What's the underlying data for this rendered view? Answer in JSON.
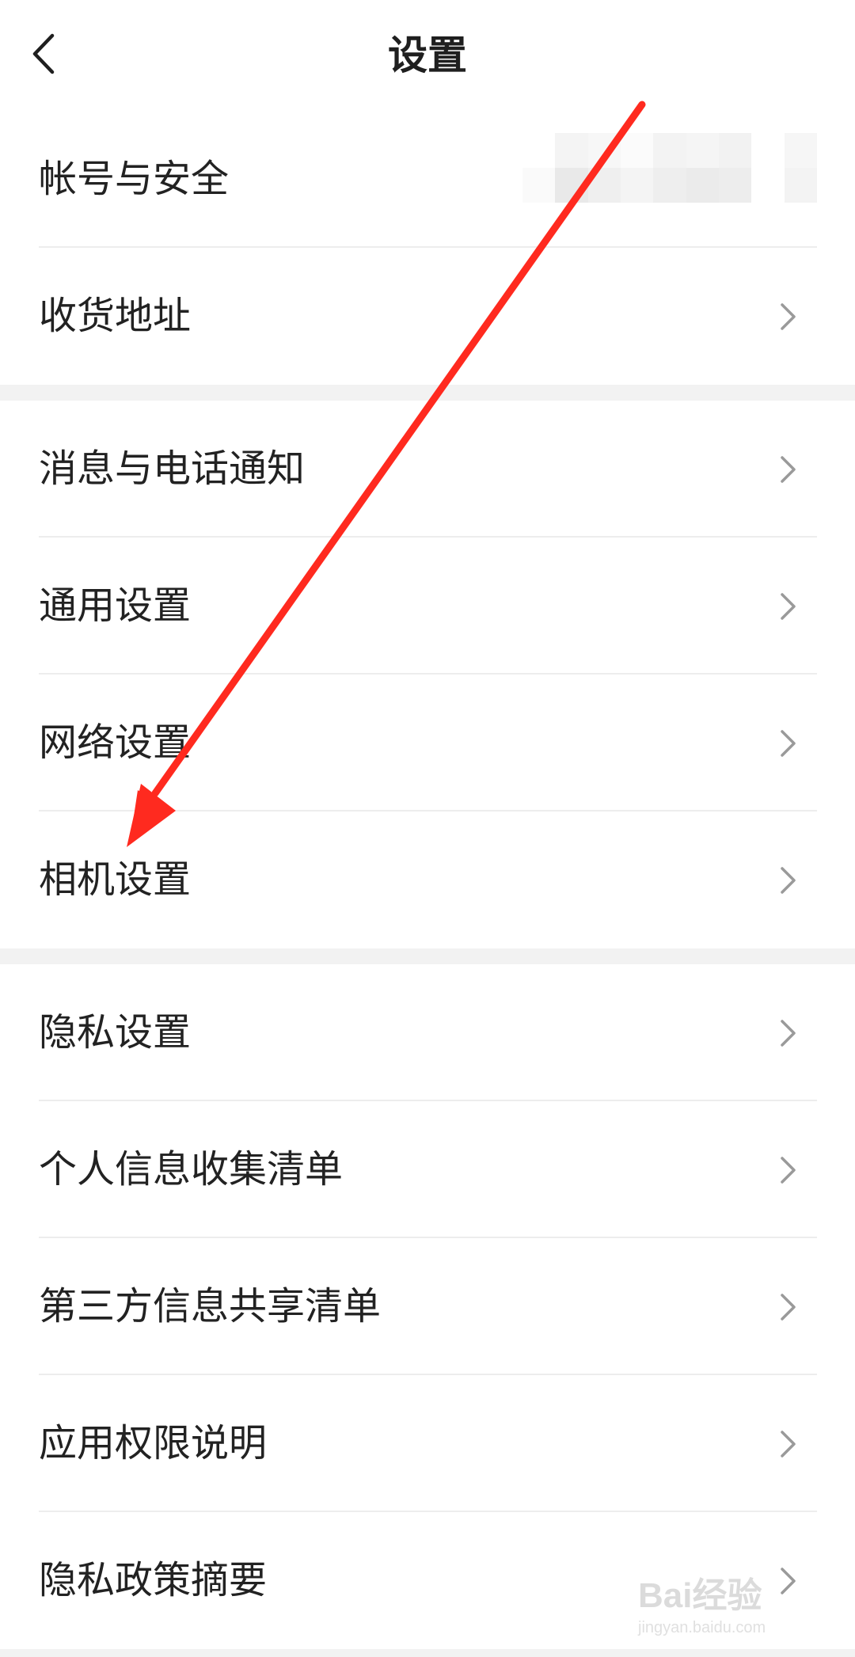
{
  "header": {
    "title": "设置",
    "back_icon": "chevron-left-icon"
  },
  "groups": [
    {
      "items": [
        {
          "label": "帐号与安全",
          "value_masked": true,
          "chevron": false
        },
        {
          "label": "收货地址",
          "chevron": true
        }
      ]
    },
    {
      "items": [
        {
          "label": "消息与电话通知",
          "chevron": true
        },
        {
          "label": "通用设置",
          "chevron": true
        },
        {
          "label": "网络设置",
          "chevron": true
        },
        {
          "label": "相机设置",
          "chevron": true
        }
      ]
    },
    {
      "items": [
        {
          "label": "隐私设置",
          "chevron": true
        },
        {
          "label": "个人信息收集清单",
          "chevron": true
        },
        {
          "label": "第三方信息共享清单",
          "chevron": true
        },
        {
          "label": "应用权限说明",
          "chevron": true
        },
        {
          "label": "隐私政策摘要",
          "chevron": true
        }
      ]
    }
  ],
  "annotation": {
    "type": "arrow",
    "color": "#ff2a1f",
    "points_to": "相机设置"
  },
  "watermark": {
    "logo_text": "Bai经验",
    "sub_text": "jingyan.baidu.com"
  },
  "colors": {
    "background": "#ffffff",
    "section_gap": "#f2f2f2",
    "divider": "#ededed",
    "text": "#222222",
    "chevron": "#9a9a9a"
  }
}
